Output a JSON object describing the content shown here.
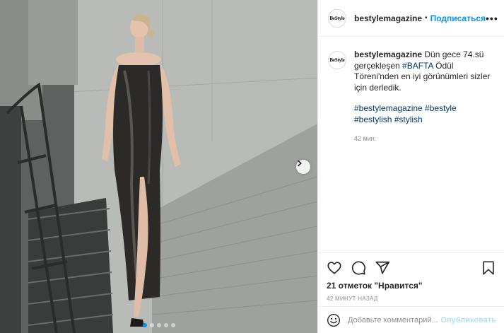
{
  "post": {
    "image": {
      "carousel_dot_count": 5,
      "active_dot": 0
    },
    "header": {
      "avatar_text": "BeStyle",
      "username": "bestylemagazine",
      "separator": "•",
      "follow_label": "Подписаться",
      "more_label": "•••"
    },
    "caption": {
      "username": "bestylemagazine",
      "text_before": "Dün gece 74.sü gerçekleşen ",
      "tag": "#BAFTA",
      "text_after": " Ödül Töreni'nden en iyi görünümleri sizler için derledik.",
      "hashtags": "#bestylemagazine #bestyle #bestylish #stylish",
      "time": "42 мин."
    },
    "likes": "21 отметок \"Нравится\"",
    "posted_ago": "42 МИНУТ НАЗАД",
    "comment": {
      "placeholder": "Добавьте комментарий...",
      "publish_label": "Опубликовать"
    },
    "colors": {
      "accent": "#0095f6",
      "hashtag": "#00376b",
      "muted": "#8e8e8e",
      "publish_disabled": "#b2dffc"
    },
    "icons": [
      "heart-icon",
      "comment-icon",
      "share-icon",
      "bookmark-icon",
      "emoji-icon",
      "chevron-right-icon"
    ]
  }
}
